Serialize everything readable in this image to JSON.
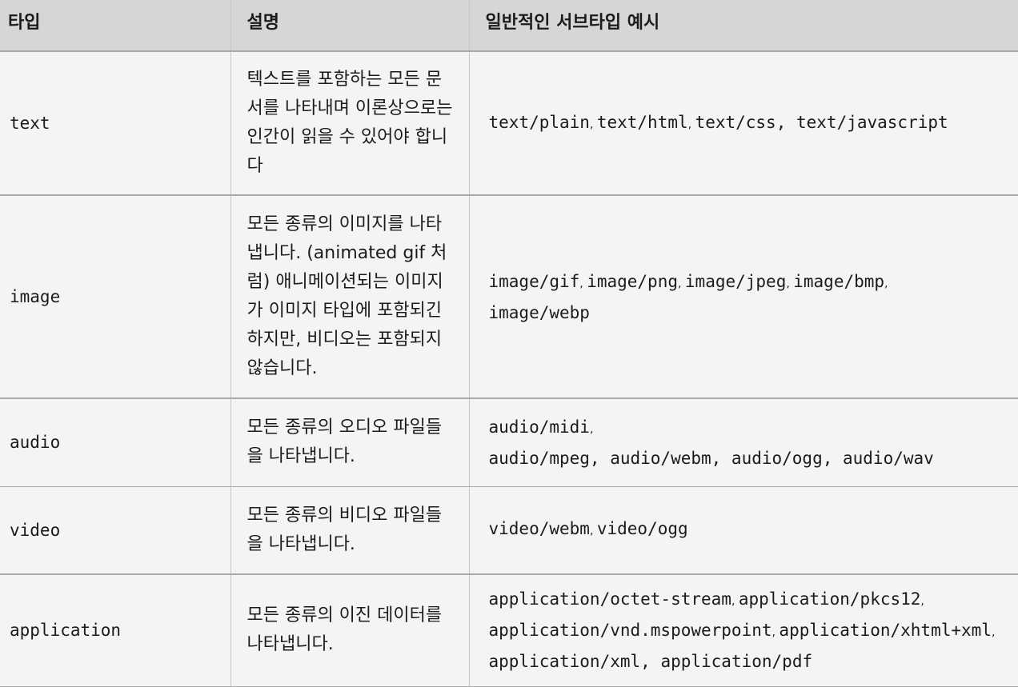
{
  "headers": {
    "type": "타입",
    "description": "설명",
    "examples": "일반적인 서브타입 예시"
  },
  "rows": [
    {
      "type": "text",
      "description": "텍스트를 포함하는 모든 문서를 나타내며 이론상으로는 인간이 읽을 수 있어야 합니다",
      "examples": [
        [
          "text/plain",
          ", ",
          "text/html",
          ", ",
          "text/css",
          ", ",
          "text/javascript"
        ]
      ]
    },
    {
      "type": "image",
      "description": "모든 종류의 이미지를 나타냅니다. (animated gif 처럼) 애니메이션되는 이미지가 이미지 타입에 포함되긴 하지만, 비디오는 포함되지 않습니다.",
      "examples": [
        [
          "image/gif",
          ", ",
          "image/png",
          ", ",
          "image/jpeg",
          ", ",
          "image/bmp",
          ","
        ],
        [
          "image/webp"
        ]
      ]
    },
    {
      "type": "audio",
      "description": "모든 종류의 오디오 파일들을 나타냅니다.",
      "examples": [
        [
          "audio/midi",
          ","
        ],
        [
          "audio/mpeg, audio/webm, audio/ogg, audio/wav"
        ]
      ]
    },
    {
      "type": "video",
      "description": "모든 종류의 비디오 파일들을 나타냅니다.",
      "examples": [
        [
          "video/webm",
          ", ",
          "video/ogg"
        ]
      ]
    },
    {
      "type": "application",
      "description": "모든 종류의 이진 데이터를 나타냅니다.",
      "examples": [
        [
          "application/octet-stream",
          ", ",
          "application/pkcs12",
          ","
        ],
        [
          "application/vnd.mspowerpoint",
          ", ",
          "application/xhtml+xml",
          ","
        ],
        [
          "application/xml",
          ",  ",
          "application/pdf"
        ]
      ]
    }
  ]
}
